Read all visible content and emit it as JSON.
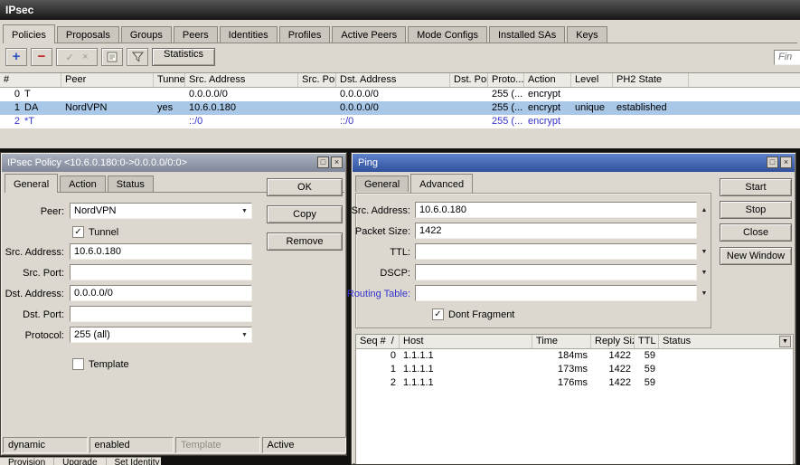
{
  "icons": {
    "add": "+",
    "remove": "−",
    "enable": "✓",
    "disable": "×",
    "close": "×",
    "restore": "□",
    "up": "▲",
    "down": "▼",
    "check": "✓",
    "sort": "/"
  },
  "colors": {
    "selected_row": "#a9c7e7",
    "dynamic_text": "#3333cc",
    "active_titlebar": "#30509c",
    "inactive_titlebar": "#7f8799",
    "main_titlebar": "#161616"
  },
  "ipsec": {
    "title": "IPsec",
    "tabs": [
      "Policies",
      "Proposals",
      "Groups",
      "Peers",
      "Identities",
      "Profiles",
      "Active Peers",
      "Mode Configs",
      "Installed SAs",
      "Keys"
    ],
    "active_tab": "Policies",
    "toolbar": {
      "statistics": "Statistics",
      "find": "Fin"
    },
    "columns": [
      "#",
      "Peer",
      "Tunnel",
      "Src. Address",
      "Src. Port",
      "Dst. Address",
      "Dst. Port",
      "Proto...",
      "Action",
      "Level",
      "PH2 State"
    ],
    "rows": [
      {
        "num": "0",
        "flags": "T",
        "peer": "",
        "tunnel": "",
        "src_address": "0.0.0.0/0",
        "src_port": "",
        "dst_address": "0.0.0.0/0",
        "dst_port": "",
        "proto": "255 (...",
        "action": "encrypt",
        "level": "",
        "ph2": ""
      },
      {
        "num": "1",
        "flags": "DA",
        "peer": "NordVPN",
        "tunnel": "yes",
        "src_address": "10.6.0.180",
        "src_port": "",
        "dst_address": "0.0.0.0/0",
        "dst_port": "",
        "proto": "255 (...",
        "action": "encrypt",
        "level": "unique",
        "ph2": "established"
      },
      {
        "num": "2",
        "flags": "*T",
        "peer": "",
        "tunnel": "",
        "src_address": "::/0",
        "src_port": "",
        "dst_address": "::/0",
        "dst_port": "",
        "proto": "255 (...",
        "action": "encrypt",
        "level": "",
        "ph2": ""
      }
    ],
    "selected_row_index": 1
  },
  "policy_dialog": {
    "title": "IPsec Policy <10.6.0.180:0->0.0.0.0/0:0>",
    "tabs": [
      "General",
      "Action",
      "Status"
    ],
    "active_tab": "General",
    "fields": {
      "peer_label": "Peer:",
      "peer_value": "NordVPN",
      "tunnel_label": "Tunnel",
      "tunnel_checked": true,
      "src_address_label": "Src. Address:",
      "src_address_value": "10.6.0.180",
      "src_port_label": "Src. Port:",
      "src_port_value": "",
      "dst_address_label": "Dst. Address:",
      "dst_address_value": "0.0.0.0/0",
      "dst_port_label": "Dst. Port:",
      "dst_port_value": "",
      "protocol_label": "Protocol:",
      "protocol_value": "255 (all)",
      "template_label": "Template",
      "template_checked": false
    },
    "buttons": [
      "OK",
      "Copy",
      "Remove"
    ],
    "status_bar": [
      "dynamic",
      "enabled",
      "Template",
      "Active"
    ]
  },
  "ping_dialog": {
    "title": "Ping",
    "tabs": [
      "General",
      "Advanced"
    ],
    "active_tab": "Advanced",
    "fields": {
      "src_address_label": "Src. Address:",
      "src_address_value": "10.6.0.180",
      "packet_size_label": "Packet Size:",
      "packet_size_value": "1422",
      "ttl_label": "TTL:",
      "ttl_value": "",
      "dscp_label": "DSCP:",
      "dscp_value": "",
      "routing_table_label": "Routing Table:",
      "routing_table_value": "",
      "dont_fragment_label": "Dont Fragment",
      "dont_fragment_checked": true
    },
    "buttons": [
      "Start",
      "Stop",
      "Close",
      "New Window"
    ],
    "table": {
      "columns": [
        "Seq #",
        "Host",
        "Time",
        "Reply Size",
        "TTL",
        "Status"
      ],
      "rows": [
        {
          "seq": "0",
          "host": "1.1.1.1",
          "time": "184ms",
          "reply_size": "1422",
          "ttl": "59",
          "status": ""
        },
        {
          "seq": "1",
          "host": "1.1.1.1",
          "time": "173ms",
          "reply_size": "1422",
          "ttl": "59",
          "status": ""
        },
        {
          "seq": "2",
          "host": "1.1.1.1",
          "time": "176ms",
          "reply_size": "1422",
          "ttl": "59",
          "status": ""
        }
      ]
    }
  },
  "background_menu": [
    "Provision",
    "Upgrade",
    "Set Identity"
  ]
}
